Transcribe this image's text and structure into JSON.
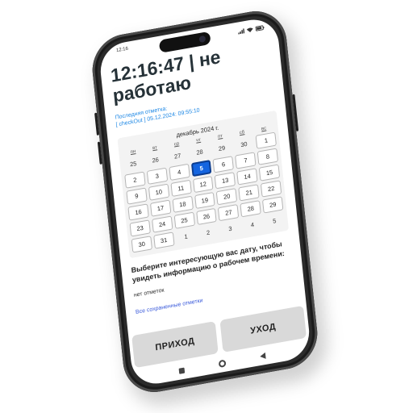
{
  "status_bar": {
    "time": "12:16"
  },
  "clock": {
    "time_status": "12:16:47 | не работаю"
  },
  "last_mark": {
    "label": "Последняя отметка:",
    "value": "[ checkOut ] 05.12.2024: 09:55:10"
  },
  "calendar": {
    "title": "декабрь 2024 г.",
    "weekdays": [
      "пн",
      "вт",
      "ср",
      "чт",
      "пт",
      "сб",
      "вс"
    ],
    "selected_day": "5",
    "days": [
      {
        "d": "25",
        "t": "out"
      },
      {
        "d": "26",
        "t": "out"
      },
      {
        "d": "27",
        "t": "out"
      },
      {
        "d": "28",
        "t": "out"
      },
      {
        "d": "29",
        "t": "out"
      },
      {
        "d": "30",
        "t": "out"
      },
      {
        "d": "1",
        "t": "cur"
      },
      {
        "d": "2",
        "t": "cur"
      },
      {
        "d": "3",
        "t": "cur"
      },
      {
        "d": "4",
        "t": "cur"
      },
      {
        "d": "5",
        "t": "sel"
      },
      {
        "d": "6",
        "t": "cur"
      },
      {
        "d": "7",
        "t": "cur"
      },
      {
        "d": "8",
        "t": "cur"
      },
      {
        "d": "9",
        "t": "cur"
      },
      {
        "d": "10",
        "t": "cur"
      },
      {
        "d": "11",
        "t": "cur"
      },
      {
        "d": "12",
        "t": "cur"
      },
      {
        "d": "13",
        "t": "cur"
      },
      {
        "d": "14",
        "t": "cur"
      },
      {
        "d": "15",
        "t": "cur"
      },
      {
        "d": "16",
        "t": "cur"
      },
      {
        "d": "17",
        "t": "cur"
      },
      {
        "d": "18",
        "t": "cur"
      },
      {
        "d": "19",
        "t": "cur"
      },
      {
        "d": "20",
        "t": "cur"
      },
      {
        "d": "21",
        "t": "cur"
      },
      {
        "d": "22",
        "t": "cur"
      },
      {
        "d": "23",
        "t": "cur"
      },
      {
        "d": "24",
        "t": "cur"
      },
      {
        "d": "25",
        "t": "cur"
      },
      {
        "d": "26",
        "t": "cur"
      },
      {
        "d": "27",
        "t": "cur"
      },
      {
        "d": "28",
        "t": "cur"
      },
      {
        "d": "29",
        "t": "cur"
      },
      {
        "d": "30",
        "t": "cur"
      },
      {
        "d": "31",
        "t": "cur"
      },
      {
        "d": "1",
        "t": "out"
      },
      {
        "d": "2",
        "t": "out"
      },
      {
        "d": "3",
        "t": "out"
      },
      {
        "d": "4",
        "t": "out"
      },
      {
        "d": "5",
        "t": "out"
      }
    ]
  },
  "prompt": "Выберите интересующую вас дату, чтобы увидеть информацию о рабочем времени:",
  "no_marks": "нет отметок",
  "all_saved_link": "Все сохраненные отметки",
  "buttons": {
    "arrival": "ПРИХОД",
    "leave": "УХОД"
  },
  "colors": {
    "accent": "#1565e0",
    "link": "#1e88e5",
    "button_bg": "#d9d9d9",
    "frame": "#2b2b2b"
  },
  "icons": {
    "nav": [
      "square-icon",
      "circle-icon",
      "back-triangle-icon"
    ]
  }
}
